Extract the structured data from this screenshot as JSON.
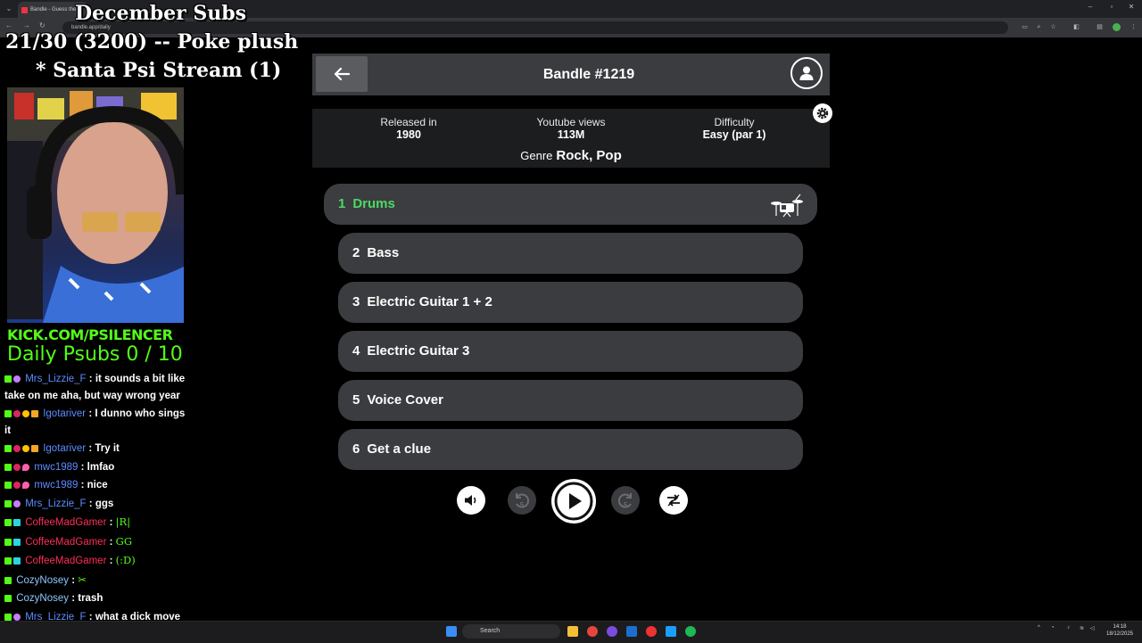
{
  "browser": {
    "tab_title": "Bandle - Guess the",
    "url": "bandle.app/daily"
  },
  "overlay": {
    "line1": "December Subs",
    "line2": "21/30 (3200) -- Poke plush",
    "line3": "* Santa Psi Stream (1)",
    "kick_url": "KICK.COM/PSILENCER",
    "daily": "Daily Psubs 0 / 10"
  },
  "chat": [
    {
      "user": "Mrs_Lizzie_F",
      "text": ": it sounds a bit like take on me aha, but way wrong year",
      "color": "#5d8cff"
    },
    {
      "user": "Igotariver",
      "text": ": I dunno who sings it",
      "color": "#5d8cff"
    },
    {
      "user": "Igotariver",
      "text": ": Try it",
      "color": "#5d8cff"
    },
    {
      "user": "mwc1989",
      "text": ": lmfao",
      "color": "#5d8cff"
    },
    {
      "user": "mwc1989",
      "text": ": nice",
      "color": "#5d8cff"
    },
    {
      "user": "Mrs_Lizzie_F",
      "text": ": ggs",
      "color": "#5d8cff"
    },
    {
      "user": "CoffeeMadGamer",
      "text": ":",
      "emote": "|R|",
      "color": "#ff2d55"
    },
    {
      "user": "CoffeeMadGamer",
      "text": ":",
      "emote": "GG",
      "color": "#ff2d55"
    },
    {
      "user": "CoffeeMadGamer",
      "text": ":",
      "emote": "(:D)",
      "color": "#ff2d55"
    },
    {
      "user": "CozyNosey",
      "text": ":",
      "emote": "✂",
      "color": "#8fc6ff"
    },
    {
      "user": "CozyNosey",
      "text": ": trash",
      "color": "#8fc6ff"
    },
    {
      "user": "Mrs_Lizzie_F",
      "text": ": what a dick move",
      "color": "#5d8cff"
    }
  ],
  "bandle": {
    "title": "Bandle #1219",
    "released_label": "Released in",
    "released_value": "1980",
    "views_label": "Youtube views",
    "views_value": "113M",
    "difficulty_label": "Difficulty",
    "difficulty_value": "Easy (par 1)",
    "genre_label": "Genre",
    "genre_value": "Rock, Pop",
    "tracks": [
      {
        "num": "1",
        "label": "Drums"
      },
      {
        "num": "2",
        "label": "Bass"
      },
      {
        "num": "3",
        "label": "Electric Guitar 1 + 2"
      },
      {
        "num": "4",
        "label": "Electric Guitar 3"
      },
      {
        "num": "5",
        "label": "Voice Cover"
      },
      {
        "num": "6",
        "label": "Get a clue"
      }
    ],
    "rewind_label": "5",
    "forward_label": "5"
  },
  "taskbar": {
    "search_placeholder": "Search",
    "time": "14:18",
    "date": "18/12/2025"
  },
  "colors": {
    "accent_green": "#4cd964",
    "kick_green": "#53fc18"
  }
}
